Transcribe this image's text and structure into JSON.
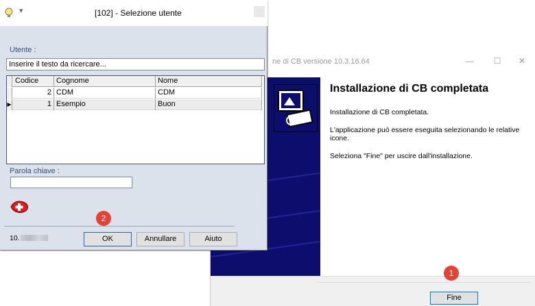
{
  "installer": {
    "title": "ne di CB versione 10.3.16.64",
    "controls": {
      "minimize": "—",
      "maximize": "☐",
      "close": "✕"
    },
    "heading": "Installazione di CB completata",
    "paragraphs": [
      "Installazione di CB completata.",
      "L'applicazione può essere eseguita selezionando le relative icone.",
      "Seleziona \"Fine\" per uscire dall'installazione."
    ],
    "finish_label": "Fine",
    "sidebar_color": "#0d0d6e"
  },
  "dialog": {
    "title": "[102] - Selezione utente",
    "quick_access_arrow": "▾",
    "user_label": "Utente :",
    "search_value": "Inserire il testo da ricercare...",
    "table": {
      "columns": [
        "Codice",
        "Cognome",
        "Nome"
      ],
      "rows": [
        {
          "code": "2",
          "surname": "CDM",
          "name": "CDM"
        },
        {
          "code": "1",
          "surname": "Esempio",
          "name": "Buon"
        }
      ],
      "current_row_marker": "▶"
    },
    "keyword_label": "Parola chiave :",
    "keyword_value": "",
    "version_prefix": "10.",
    "buttons": {
      "ok": "OK",
      "cancel": "Annullare",
      "help": "Aiuto"
    },
    "background_color": "#dbe2ec"
  },
  "markers": [
    {
      "number": "1",
      "target": "installer-finish-button"
    },
    {
      "number": "2",
      "target": "ok-button"
    }
  ],
  "colors": {
    "marker": "#e34234"
  }
}
